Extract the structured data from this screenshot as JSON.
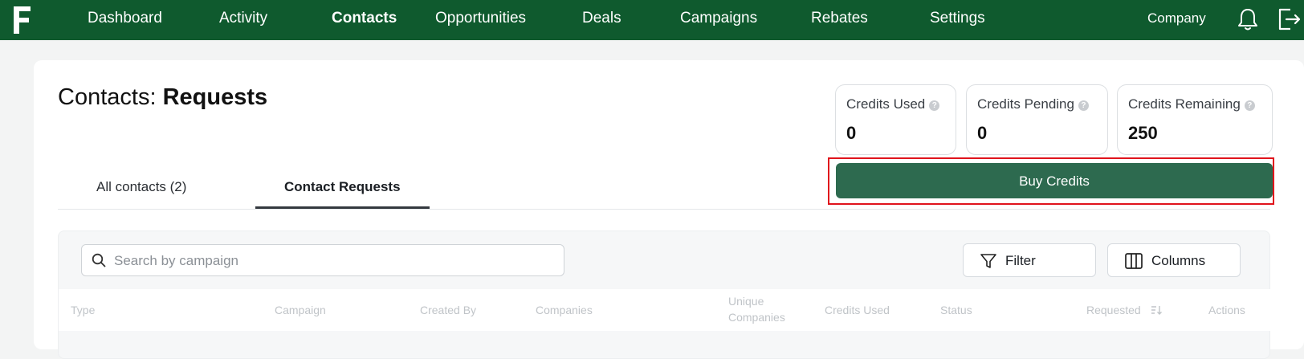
{
  "nav": {
    "items": [
      {
        "label": "Dashboard",
        "active": false
      },
      {
        "label": "Activity",
        "active": false
      },
      {
        "label": "Contacts",
        "active": true
      },
      {
        "label": "Opportunities",
        "active": false
      },
      {
        "label": "Deals",
        "active": false
      },
      {
        "label": "Campaigns",
        "active": false
      },
      {
        "label": "Rebates",
        "active": false
      },
      {
        "label": "Settings",
        "active": false
      }
    ],
    "company": "Company",
    "bg_color": "#0f5a2e"
  },
  "page": {
    "title_prefix": "Contacts:",
    "title_bold": "Requests"
  },
  "stats": [
    {
      "label": "Credits Used",
      "value": "0"
    },
    {
      "label": "Credits Pending",
      "value": "0"
    },
    {
      "label": "Credits Remaining",
      "value": "250"
    }
  ],
  "buy_button": {
    "label": "Buy Credits",
    "color": "#2d6a4f",
    "highlight_color": "#e0141c"
  },
  "tabs": [
    {
      "label": "All contacts (2)",
      "active": false
    },
    {
      "label": "Contact Requests",
      "active": true
    }
  ],
  "search": {
    "placeholder": "Search by campaign",
    "value": ""
  },
  "toolbar": {
    "filter_label": "Filter",
    "columns_label": "Columns"
  },
  "table": {
    "columns": [
      "Type",
      "Campaign",
      "Created By",
      "Companies",
      "Unique Companies",
      "Credits Used",
      "Status",
      "Requested",
      "Actions"
    ]
  },
  "icons": {
    "logo": "brand-f-logo",
    "bell": "bell-icon",
    "logout": "logout-icon",
    "search": "search-icon",
    "filter": "filter-icon",
    "columns": "columns-icon",
    "help": "help-circle-icon",
    "sort": "sort-icon"
  }
}
